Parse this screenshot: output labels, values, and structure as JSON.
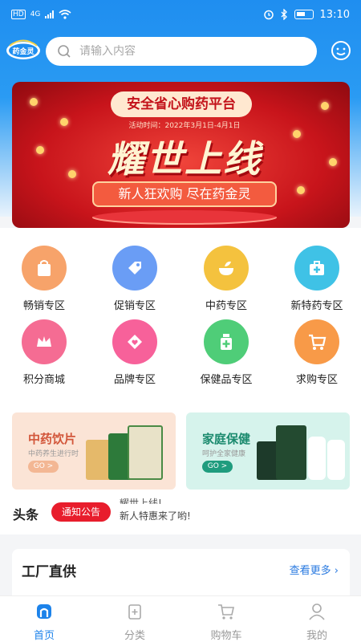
{
  "status": {
    "time": "13:10",
    "hd": "HD",
    "net": "4G"
  },
  "logo": {
    "text": "药金灵"
  },
  "search": {
    "placeholder": "请输入内容"
  },
  "banner": {
    "platform": "安全省心购药平台",
    "date": "活动时间：2022年3月1日-4月1日",
    "headline": "耀世上线",
    "slogan": "新人狂欢购  尽在药金灵"
  },
  "categories": [
    {
      "label": "畅销专区",
      "icon": "shopping-bag-icon",
      "color": "#f7a36a"
    },
    {
      "label": "促销专区",
      "icon": "price-tag-icon",
      "color": "#6a9df5"
    },
    {
      "label": "中药专区",
      "icon": "herbal-bowl-icon",
      "color": "#f4c23e"
    },
    {
      "label": "新特药专区",
      "icon": "medical-kit-icon",
      "color": "#3fc2e6"
    },
    {
      "label": "积分商城",
      "icon": "crown-icon",
      "color": "#f56c93"
    },
    {
      "label": "品牌专区",
      "icon": "heart-badge-icon",
      "color": "#f7619a"
    },
    {
      "label": "保健品专区",
      "icon": "medicine-bottle-icon",
      "color": "#4fcd78"
    },
    {
      "label": "求购专区",
      "icon": "shopping-cart-icon",
      "color": "#f89a48"
    }
  ],
  "promos": [
    {
      "title": "中药饮片",
      "subtitle": "中药养生进行时",
      "go": "GO >",
      "color": "#d2563a",
      "bg": "#fbe4d6",
      "go_bg": "#f3b794"
    },
    {
      "title": "家庭保健",
      "subtitle": "呵护全家健康",
      "go": "GO >",
      "color": "#1b8a6e",
      "bg": "#d6f3ec",
      "go_bg": "#1f9c7e"
    }
  ],
  "news": {
    "heading": "头条",
    "tag": "通知公告",
    "line1": "耀世上线!",
    "line2": "新人特惠来了哟!"
  },
  "factory": {
    "title": "工厂直供",
    "more": "查看更多"
  },
  "tabs": [
    {
      "label": "首页",
      "icon": "home-icon",
      "active": true
    },
    {
      "label": "分类",
      "icon": "category-icon",
      "active": false
    },
    {
      "label": "购物车",
      "icon": "cart-icon",
      "active": false
    },
    {
      "label": "我的",
      "icon": "user-icon",
      "active": false
    }
  ]
}
